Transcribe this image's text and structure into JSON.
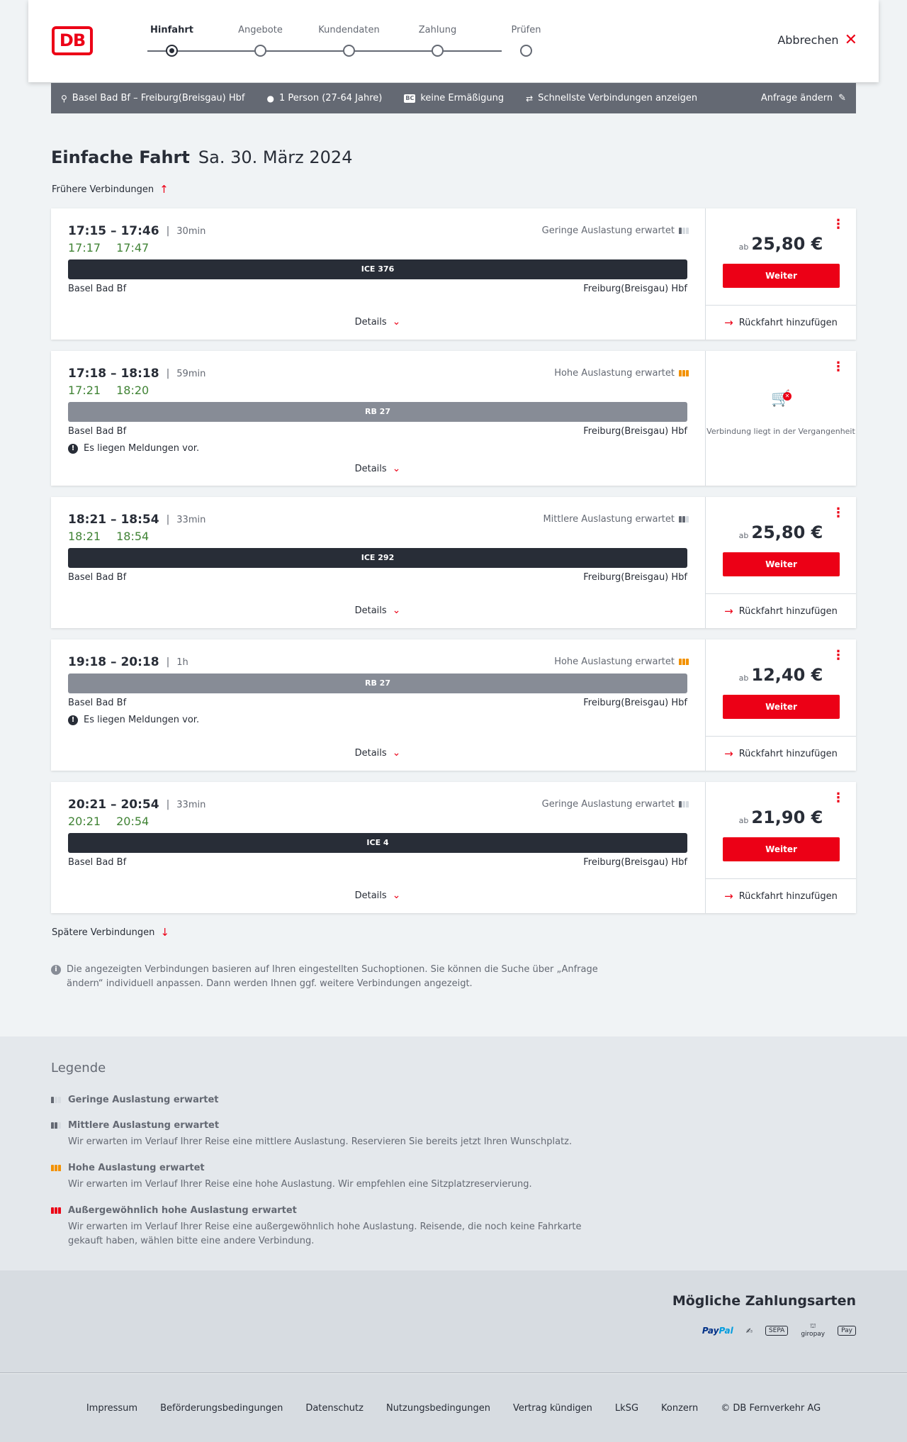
{
  "logo": "DB",
  "steps": [
    {
      "label": "Hinfahrt"
    },
    {
      "label": "Angebote"
    },
    {
      "label": "Kundendaten"
    },
    {
      "label": "Zahlung"
    },
    {
      "label": "Prüfen"
    }
  ],
  "cancel_label": "Abbrechen",
  "search": {
    "route": "Basel Bad Bf – Freiburg(Breisgau) Hbf",
    "passengers": "1 Person (27-64 Jahre)",
    "bc_badge": "BC",
    "discount": "keine Ermäßigung",
    "option": "Schnellste Verbindungen anzeigen",
    "edit": "Anfrage ändern"
  },
  "title": {
    "main": "Einfache Fahrt",
    "date": "Sa. 30. März 2024"
  },
  "earlier": "Frühere Verbindungen",
  "later": "Spätere Verbindungen",
  "connections": [
    {
      "times": "17:15 – 17:46",
      "duration": "30min",
      "rt_dep": "17:17",
      "rt_arr": "17:47",
      "load": "Geringe Auslastung erwartet",
      "train": "ICE 376",
      "from": "Basel Bad Bf",
      "to": "Freiburg(Breisgau) Hbf",
      "details": "Details",
      "price_prefix": "ab",
      "price": "25,80 €",
      "button": "Weiter",
      "return": "Rückfahrt hinzufügen"
    },
    {
      "times": "17:18 – 18:18",
      "duration": "59min",
      "rt_dep": "17:21",
      "rt_arr": "18:20",
      "load": "Hohe Auslastung erwartet",
      "train": "RB 27",
      "from": "Basel Bad Bf",
      "to": "Freiburg(Breisgau) Hbf",
      "notice": "Es liegen Meldungen vor.",
      "details": "Details",
      "past": "Verbindung liegt in der Vergangenheit"
    },
    {
      "times": "18:21 – 18:54",
      "duration": "33min",
      "rt_dep": "18:21",
      "rt_arr": "18:54",
      "load": "Mittlere Auslastung erwartet",
      "train": "ICE 292",
      "from": "Basel Bad Bf",
      "to": "Freiburg(Breisgau) Hbf",
      "details": "Details",
      "price_prefix": "ab",
      "price": "25,80 €",
      "button": "Weiter",
      "return": "Rückfahrt hinzufügen"
    },
    {
      "times": "19:18 – 20:18",
      "duration": "1h",
      "load": "Hohe Auslastung erwartet",
      "train": "RB 27",
      "from": "Basel Bad Bf",
      "to": "Freiburg(Breisgau) Hbf",
      "notice": "Es liegen Meldungen vor.",
      "details": "Details",
      "price_prefix": "ab",
      "price": "12,40 €",
      "button": "Weiter",
      "return": "Rückfahrt hinzufügen"
    },
    {
      "times": "20:21 – 20:54",
      "duration": "33min",
      "rt_dep": "20:21",
      "rt_arr": "20:54",
      "load": "Geringe Auslastung erwartet",
      "train": "ICE 4",
      "from": "Basel Bad Bf",
      "to": "Freiburg(Breisgau) Hbf",
      "details": "Details",
      "price_prefix": "ab",
      "price": "21,90 €",
      "button": "Weiter",
      "return": "Rückfahrt hinzufügen"
    }
  ],
  "info_note": "Die angezeigten Verbindungen basieren auf Ihren eingestellten Suchoptionen. Sie können die Suche über „Anfrage ändern“ individuell anpassen. Dann werden Ihnen ggf. weitere Verbindungen angezeigt.",
  "legend": {
    "title": "Legende",
    "items": [
      {
        "head": "Geringe Auslastung erwartet"
      },
      {
        "head": "Mittlere Auslastung erwartet",
        "desc": "Wir erwarten im Verlauf Ihrer Reise eine mittlere Auslastung. Reservieren Sie bereits jetzt Ihren Wunschplatz."
      },
      {
        "head": "Hohe Auslastung erwartet",
        "desc": "Wir erwarten im Verlauf Ihrer Reise eine hohe Auslastung. Wir empfehlen eine Sitzplatzreservierung."
      },
      {
        "head": "Außergewöhnlich hohe Auslastung erwartet",
        "desc": "Wir erwarten im Verlauf Ihrer Reise eine außergewöhnlich hohe Auslastung. Reisende, die noch keine Fahrkarte gekauft haben, wählen bitte eine andere Verbindung."
      }
    ]
  },
  "payment": {
    "title": "Mögliche Zahlungsarten",
    "paypal_a": "Pay",
    "paypal_b": "Pal",
    "sepa": "SEPA",
    "giropay": "giropay",
    "applepay": "Pay"
  },
  "footer": [
    "Impressum",
    "Beförderungsbedingungen",
    "Datenschutz",
    "Nutzungsbedingungen",
    "Vertrag kündigen",
    "LkSG",
    "Konzern",
    "© DB Fernverkehr AG"
  ]
}
